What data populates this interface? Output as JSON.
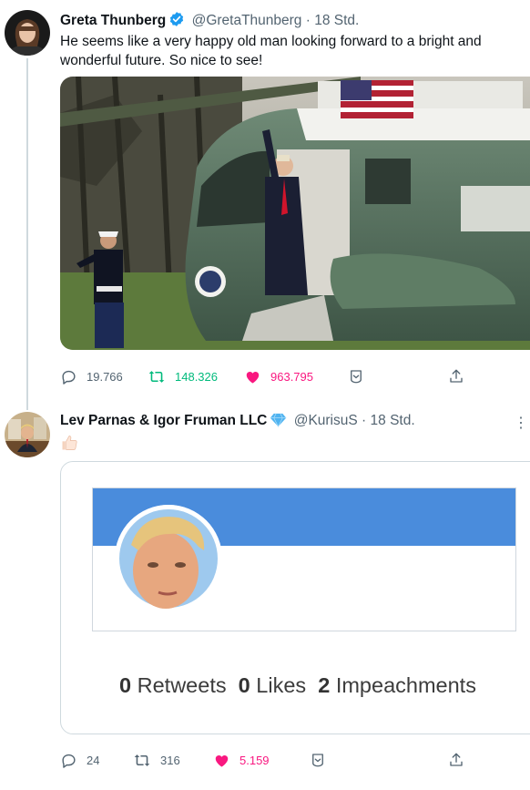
{
  "tweet1": {
    "name": "Greta Thunberg",
    "handle": "@GretaThunberg",
    "separator": "·",
    "time": "18 Std.",
    "text": "He seems like a very happy old man looking forward to a bright and wonderful future. So nice to see!",
    "actions": {
      "replies": "19.766",
      "retweets": "148.326",
      "likes": "963.795"
    }
  },
  "tweet2": {
    "name": "Lev Parnas & Igor Fruman LLC",
    "handle": "@KurisuS",
    "separator": "·",
    "time": "18 Std.",
    "card": {
      "retweets_count": "0",
      "retweets_label": "Retweets",
      "likes_count": "0",
      "likes_label": "Likes",
      "impeachments_count": "2",
      "impeachments_label": "Impeachments"
    },
    "actions": {
      "replies": "24",
      "retweets": "316",
      "likes": "5.159"
    }
  },
  "colors": {
    "verified": "#1d9bf0",
    "retweet": "#00ba7c",
    "like": "#f91880",
    "banner": "#4a8cdc",
    "muted": "#536471"
  },
  "icons": [
    "verified-badge-icon",
    "diamond-icon",
    "thumbs-up-emoji",
    "reply-icon",
    "retweet-icon",
    "like-icon",
    "bookmark-icon",
    "share-icon",
    "more-icon"
  ]
}
